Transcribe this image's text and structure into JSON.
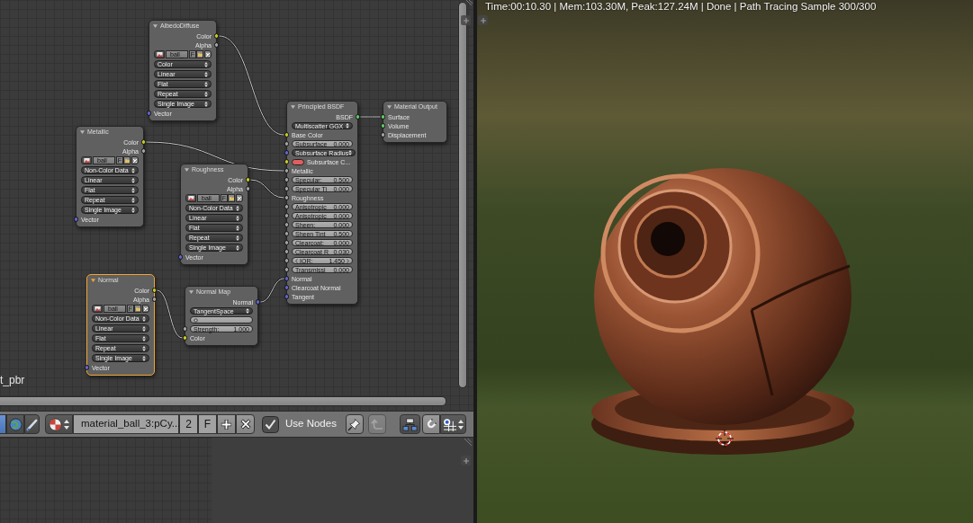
{
  "node_editor": {
    "nodes": [
      {
        "kind": "image_texture",
        "title": "AlbedoDiffuse",
        "selected": false,
        "rows": [
          {
            "kind": "output",
            "label": "Color",
            "socket": {
              "kind": "color"
            }
          },
          {
            "kind": "output",
            "label": "Alpha",
            "socket": {
              "kind": "float"
            }
          },
          {
            "kind": "image",
            "name": "ball_",
            "fake_user": "F"
          },
          {
            "kind": "dropdown",
            "value": "Color"
          },
          {
            "kind": "dropdown",
            "value": "Linear"
          },
          {
            "kind": "dropdown",
            "value": "Flat"
          },
          {
            "kind": "dropdown",
            "value": "Repeat"
          },
          {
            "kind": "dropdown",
            "value": "Single Image"
          },
          {
            "kind": "input",
            "label": "Vector",
            "socket": {
              "kind": "vector"
            }
          }
        ]
      },
      {
        "kind": "image_texture",
        "title": "Metallic",
        "selected": false,
        "rows": [
          {
            "kind": "output",
            "label": "Color",
            "socket": {
              "kind": "color"
            }
          },
          {
            "kind": "output",
            "label": "Alpha",
            "socket": {
              "kind": "float"
            }
          },
          {
            "kind": "image",
            "name": "ball_",
            "fake_user": "F"
          },
          {
            "kind": "dropdown",
            "value": "Non-Color Data"
          },
          {
            "kind": "dropdown",
            "value": "Linear"
          },
          {
            "kind": "dropdown",
            "value": "Flat"
          },
          {
            "kind": "dropdown",
            "value": "Repeat"
          },
          {
            "kind": "dropdown",
            "value": "Single Image"
          },
          {
            "kind": "input",
            "label": "Vector",
            "socket": {
              "kind": "vector"
            }
          }
        ]
      },
      {
        "kind": "image_texture",
        "title": "Roughness",
        "selected": false,
        "rows": [
          {
            "kind": "output",
            "label": "Color",
            "socket": {
              "kind": "color"
            }
          },
          {
            "kind": "output",
            "label": "Alpha",
            "socket": {
              "kind": "float"
            }
          },
          {
            "kind": "image",
            "name": "ball_",
            "fake_user": "F"
          },
          {
            "kind": "dropdown",
            "value": "Non-Color Data"
          },
          {
            "kind": "dropdown",
            "value": "Linear"
          },
          {
            "kind": "dropdown",
            "value": "Flat"
          },
          {
            "kind": "dropdown",
            "value": "Repeat"
          },
          {
            "kind": "dropdown",
            "value": "Single Image"
          },
          {
            "kind": "input",
            "label": "Vector",
            "socket": {
              "kind": "vector"
            }
          }
        ]
      },
      {
        "kind": "shader",
        "title": "Principled BSDF",
        "selected": false,
        "rows": [
          {
            "kind": "output",
            "label": "BSDF",
            "socket": {
              "kind": "shader"
            }
          },
          {
            "kind": "dropdown",
            "value": "Multiscatter GGX"
          },
          {
            "kind": "input",
            "label": "Base Color",
            "socket": {
              "kind": "color"
            }
          },
          {
            "kind": "slider",
            "label": "Subsurface",
            "value": "0.000",
            "socket": {
              "kind": "float"
            }
          },
          {
            "kind": "dropdown",
            "value": "Subsurface Radius",
            "socket": {
              "kind": "vector"
            }
          },
          {
            "kind": "color",
            "label": "Subsurface C...",
            "socket": {
              "kind": "color"
            },
            "color": "#df5f5f"
          },
          {
            "kind": "input",
            "label": "Metallic",
            "socket": {
              "kind": "float"
            }
          },
          {
            "kind": "slider",
            "label": "Specular:",
            "value": "0.500",
            "socket": {
              "kind": "float"
            }
          },
          {
            "kind": "slider",
            "label": "Specular Ti",
            "value": "0.000",
            "socket": {
              "kind": "float"
            }
          },
          {
            "kind": "input",
            "label": "Roughness",
            "socket": {
              "kind": "float"
            }
          },
          {
            "kind": "slider",
            "label": "Anisotropic",
            "value": "0.000",
            "socket": {
              "kind": "float"
            }
          },
          {
            "kind": "slider",
            "label": "Anisotropic",
            "value": "0.000",
            "socket": {
              "kind": "float"
            }
          },
          {
            "kind": "slider",
            "label": "Sheen:",
            "value": "0.000",
            "socket": {
              "kind": "float"
            }
          },
          {
            "kind": "slider",
            "label": "Sheen Tint",
            "value": "0.500",
            "socket": {
              "kind": "float"
            }
          },
          {
            "kind": "slider",
            "label": "Clearcoat:",
            "value": "0.000",
            "socket": {
              "kind": "float"
            }
          },
          {
            "kind": "slider",
            "label": "Clearcoat R",
            "value": "0.030",
            "socket": {
              "kind": "float"
            }
          },
          {
            "kind": "number",
            "label": "IOR:",
            "value": "1.450",
            "socket": {
              "kind": "float"
            }
          },
          {
            "kind": "slider",
            "label": "Transmissi",
            "value": "0.000",
            "socket": {
              "kind": "float"
            }
          },
          {
            "kind": "input",
            "label": "Normal",
            "socket": {
              "kind": "vector"
            }
          },
          {
            "kind": "input",
            "label": "Clearcoat Normal",
            "socket": {
              "kind": "vector"
            }
          },
          {
            "kind": "input",
            "label": "Tangent",
            "socket": {
              "kind": "vector"
            }
          }
        ]
      },
      {
        "kind": "output",
        "title": "Material Output",
        "selected": false,
        "rows": [
          {
            "kind": "input",
            "label": "Surface",
            "socket": {
              "kind": "shader"
            }
          },
          {
            "kind": "input",
            "label": "Volume",
            "socket": {
              "kind": "shader"
            }
          },
          {
            "kind": "input",
            "label": "Displacement",
            "socket": {
              "kind": "float"
            }
          }
        ]
      },
      {
        "kind": "image_texture",
        "title": "Normal",
        "selected": true,
        "rows": [
          {
            "kind": "output",
            "label": "Color",
            "socket": {
              "kind": "color"
            }
          },
          {
            "kind": "output",
            "label": "Alpha",
            "socket": {
              "kind": "float"
            }
          },
          {
            "kind": "image",
            "name": "ball_",
            "fake_user": "F"
          },
          {
            "kind": "dropdown",
            "value": "Non-Color Data"
          },
          {
            "kind": "dropdown",
            "value": "Linear"
          },
          {
            "kind": "dropdown",
            "value": "Flat"
          },
          {
            "kind": "dropdown",
            "value": "Repeat"
          },
          {
            "kind": "dropdown",
            "value": "Single Image"
          },
          {
            "kind": "input",
            "label": "Vector",
            "socket": {
              "kind": "vector"
            }
          }
        ]
      },
      {
        "kind": "vector",
        "title": "Normal Map",
        "selected": false,
        "rows": [
          {
            "kind": "output",
            "label": "Normal",
            "socket": {
              "kind": "vector"
            }
          },
          {
            "kind": "dropdown",
            "value": "TangentSpace"
          },
          {
            "kind": "uv_field"
          },
          {
            "kind": "slider",
            "label": "Strength:",
            "value": "1.000",
            "socket": {
              "kind": "float"
            }
          },
          {
            "kind": "input",
            "label": "Color",
            "socket": {
              "kind": "color"
            }
          }
        ]
      }
    ],
    "name_label": "t_pbr"
  },
  "header": {
    "tree_types": [
      {
        "selected": true
      },
      {
        "selected": false
      },
      {
        "selected": false
      }
    ],
    "material": {
      "name": "material_ball_3:pCy...",
      "users": "2",
      "fake_user": "F"
    },
    "use_nodes": {
      "label": "Use Nodes",
      "checked": true
    },
    "parent_button": {
      "disabled": true
    }
  },
  "viewport": {
    "status": "Time:00:10.30 | Mem:103.30M, Peak:127.24M | Done | Path Tracing Sample 300/300"
  }
}
